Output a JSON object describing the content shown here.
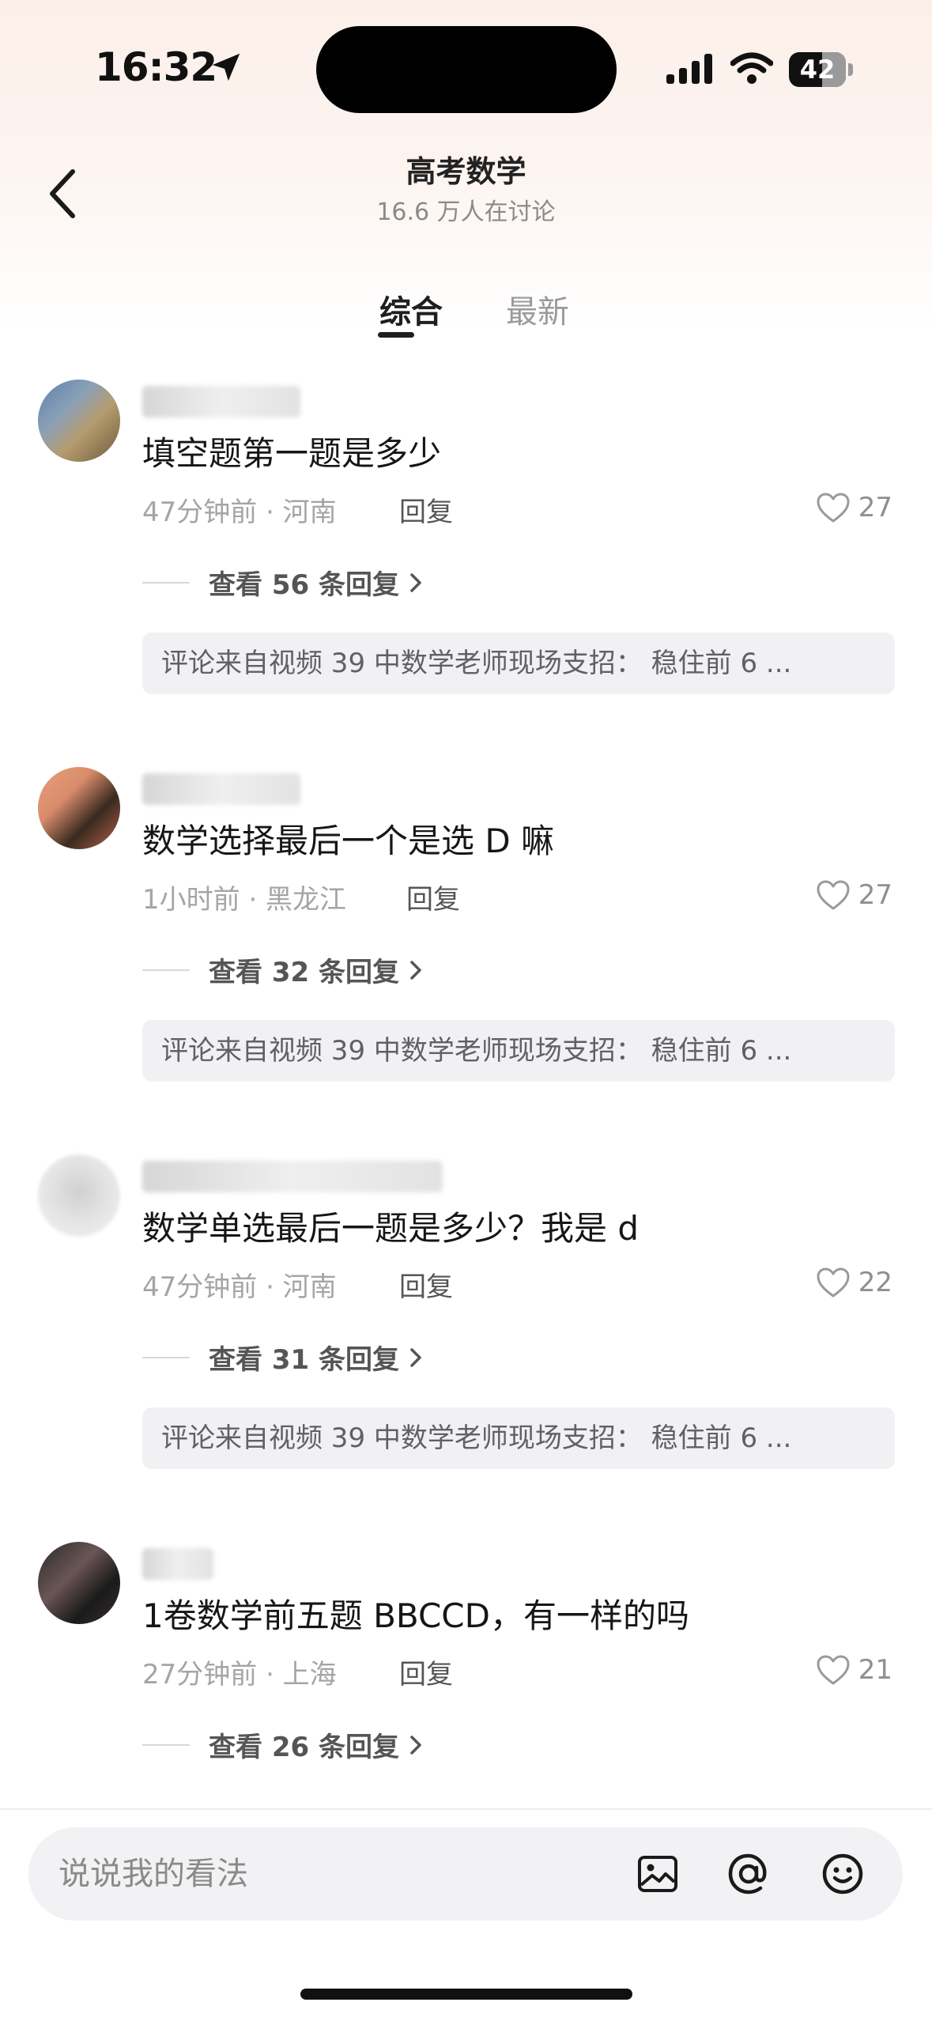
{
  "status_bar": {
    "time": "16:32",
    "battery": "42",
    "icons": [
      "location-arrow-icon",
      "signal-icon",
      "wifi-icon",
      "battery-icon"
    ]
  },
  "header": {
    "title": "高考数学",
    "subtitle": "16.6 万人在讨论",
    "back_icon": "chevron-left-icon"
  },
  "tabs": [
    {
      "label": "综合",
      "active": true
    },
    {
      "label": "最新",
      "active": false
    }
  ],
  "comments": [
    {
      "text": "填空题第一题是多少",
      "time": "47分钟前 · 河南",
      "reply_label": "回复",
      "likes": "27",
      "view_replies": "查看 56 条回复",
      "source": "评论来自视频 39 中数学老师现场支招： 稳住前 6 ..."
    },
    {
      "text": "数学选择最后一个是选 D 嘛",
      "time": "1小时前 · 黑龙江",
      "reply_label": "回复",
      "likes": "27",
      "view_replies": "查看 32 条回复",
      "source": "评论来自视频 39 中数学老师现场支招： 稳住前 6 ..."
    },
    {
      "text": "数学单选最后一题是多少？我是 d",
      "time": "47分钟前 · 河南",
      "reply_label": "回复",
      "likes": "22",
      "view_replies": "查看 31 条回复",
      "source": "评论来自视频 39 中数学老师现场支招： 稳住前 6 ..."
    },
    {
      "text": "1卷数学前五题 BBCCD，有一样的吗",
      "time": "27分钟前 · 上海",
      "reply_label": "回复",
      "likes": "21",
      "view_replies": "查看 26 条回复"
    }
  ],
  "input": {
    "placeholder": "说说我的看法",
    "icons": [
      "image-icon",
      "at-icon",
      "emoji-icon"
    ]
  },
  "colors": {
    "header_gradient": "#fbefe9",
    "text_primary": "#161616",
    "text_secondary": "#a5a5a5",
    "source_bg": "#f1f1f3"
  }
}
